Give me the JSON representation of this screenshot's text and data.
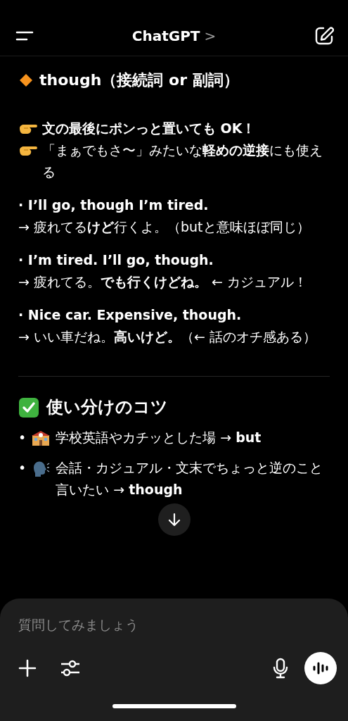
{
  "header": {
    "title": "ChatGPT",
    "chevron": ">"
  },
  "section": {
    "heading": "though（接続詞 or 副詞）",
    "points": [
      {
        "text": "文の最後にポンっと置いても OK！",
        "bold": true
      },
      {
        "text": "「まぁでもさ〜」みたいな**軽めの逆接**にも使える",
        "bold": false
      }
    ],
    "examples": [
      {
        "sentence": "· I’ll go, though I’m tired.",
        "translation": "→ 疲れてる**けど**行くよ。（butと意味ほぼ同じ）"
      },
      {
        "sentence": "· I’m tired. I’ll go, though.",
        "translation": "→ 疲れてる。**でも行くけどね。** ← カジュアル！"
      },
      {
        "sentence": "· Nice car. Expensive, though.",
        "translation": "→ いい車だね。**高いけど。**（← 話のオチ感ある）"
      }
    ]
  },
  "tips": {
    "heading": "使い分けのコツ",
    "items": [
      {
        "bullet": "•",
        "kind": "school",
        "text": "学校英語やカチッとした場 → **but**"
      },
      {
        "bullet": "•",
        "kind": "speaker",
        "text": "会話・カジュアル・文末でちょっと逆のこと言いたい → **though**"
      }
    ]
  },
  "composer": {
    "placeholder": "質問してみましょう"
  }
}
